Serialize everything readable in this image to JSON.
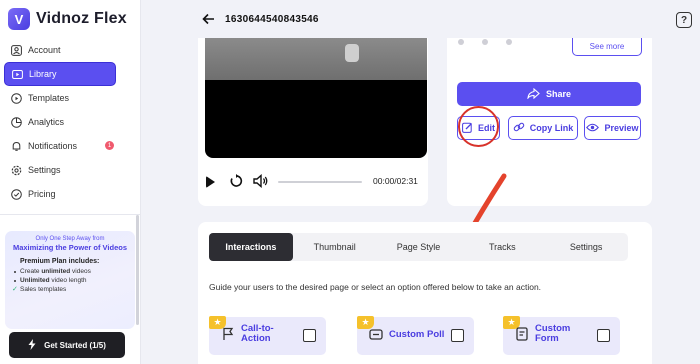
{
  "app": {
    "name": "Vidnoz Flex",
    "logo_letter": "V"
  },
  "sidebar": {
    "items": [
      {
        "label": "Account",
        "icon": "user-icon"
      },
      {
        "label": "Library",
        "icon": "library-icon",
        "active": true
      },
      {
        "label": "Templates",
        "icon": "templates-icon"
      },
      {
        "label": "Analytics",
        "icon": "analytics-icon"
      },
      {
        "label": "Notifications",
        "icon": "bell-icon",
        "badge": "1"
      },
      {
        "label": "Settings",
        "icon": "gear-icon"
      },
      {
        "label": "Pricing",
        "icon": "pricing-icon"
      }
    ]
  },
  "promo": {
    "top": "Only One Step Away from",
    "headline": "Maximizing the Power of Videos",
    "subhead": "Premium Plan includes:",
    "feature1_bold": "unlimited",
    "feature1_pre": "Create ",
    "feature1_post": " videos",
    "feature2_bold": "Unlimited",
    "feature2_post": " video length",
    "feature3": "Sales templates"
  },
  "get_started": {
    "label": "Get Started (1/5)"
  },
  "header": {
    "video_id": "1630644540843546",
    "back_icon": "arrow-left-icon",
    "help_icon": "help-icon"
  },
  "player": {
    "time": "00:00/02:31",
    "progress": 0
  },
  "actions": {
    "see_more": "See more",
    "share": "Share",
    "edit": "Edit",
    "copy_link": "Copy Link",
    "preview": "Preview"
  },
  "tabs": [
    "Interactions",
    "Thumbnail",
    "Page Style",
    "Tracks",
    "Settings"
  ],
  "active_tab": "Interactions",
  "guide_text": "Guide your users to the desired page or select an option offered below to take an action.",
  "options": [
    {
      "label_line1": "Call-to-",
      "label_line2": "Action",
      "icon": "flag-icon"
    },
    {
      "label_line1": "Custom Poll",
      "label_line2": "",
      "icon": "poll-icon"
    },
    {
      "label_line1": "Custom",
      "label_line2": "Form",
      "icon": "form-icon"
    }
  ],
  "colors": {
    "accent": "#5b4ff0",
    "annotation": "#d8322a",
    "star": "#f5c12b"
  }
}
